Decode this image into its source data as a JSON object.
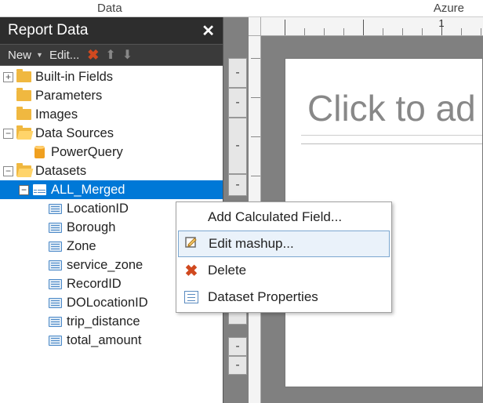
{
  "menu": {
    "data": "Data",
    "azure": "Azure"
  },
  "panel": {
    "title": "Report Data",
    "toolbar": {
      "new": "New",
      "edit": "Edit..."
    }
  },
  "tree": {
    "builtin": "Built-in Fields",
    "parameters": "Parameters",
    "images": "Images",
    "datasources": "Data Sources",
    "powerquery": "PowerQuery",
    "datasets": "Datasets",
    "allmerged": "ALL_Merged",
    "fields": [
      "LocationID",
      "Borough",
      "Zone",
      "service_zone",
      "RecordID",
      "DOLocationID",
      "trip_distance",
      "total_amount"
    ]
  },
  "context": {
    "addcalc": "Add Calculated Field...",
    "editmashup": "Edit mashup...",
    "delete": "Delete",
    "props": "Dataset Properties"
  },
  "designer": {
    "title_placeholder": "Click to ad",
    "ruler_label": "1"
  }
}
